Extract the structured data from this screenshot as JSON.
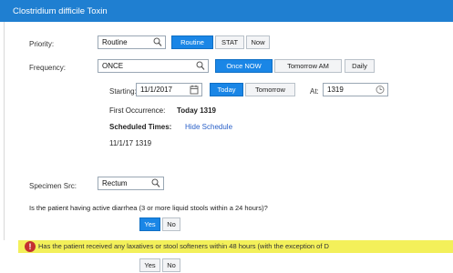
{
  "header": {
    "title": "Clostridium difficile Toxin"
  },
  "priority": {
    "label": "Priority:",
    "value": "Routine",
    "options": [
      "Routine",
      "STAT",
      "Now"
    ]
  },
  "frequency": {
    "label": "Frequency:",
    "value": "ONCE",
    "options": [
      "Once NOW",
      "Tomorrow AM",
      "Daily"
    ]
  },
  "starting": {
    "label": "Starting:",
    "date": "11/1/2017",
    "options": [
      "Today",
      "Tomorrow"
    ],
    "at_label": "At:",
    "time": "1319"
  },
  "first_occurrence": {
    "label": "First Occurrence:",
    "value": "Today 1319"
  },
  "scheduled": {
    "label": "Scheduled Times:",
    "link": "Hide Schedule",
    "entry": "11/1/17 1319"
  },
  "specimen": {
    "label": "Specimen Src:",
    "value": "Rectum"
  },
  "question1": {
    "text": "Is the patient having active diarrhea (3 or more liquid stools within a 24 hours)?",
    "options": [
      "Yes",
      "No"
    ]
  },
  "question2": {
    "text": "Has the patient received any laxatives or stool softeners within 48 hours (with the exception of D",
    "options": [
      "Yes",
      "No"
    ]
  }
}
